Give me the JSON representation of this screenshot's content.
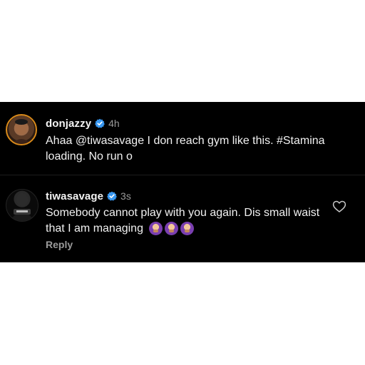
{
  "comments": [
    {
      "username": "donjazzy",
      "time": "4h",
      "text": "Ahaa @tiwasavage I don reach gym like this. #Stamina loading. No run o",
      "avatar_icon": "profile-photo-orange-ring-icon"
    },
    {
      "username": "tiwasavage",
      "time": "3s",
      "text": "Somebody cannot play with you again. Dis small waist that I am managing",
      "emojis": [
        "woman-shrugging-emoji",
        "woman-shrugging-emoji",
        "woman-shrugging-emoji"
      ],
      "reply_label": "Reply",
      "avatar_icon": "profile-photo-icon",
      "like_icon": "heart-outline-icon"
    }
  ],
  "colors": {
    "panel_bg": "#000000",
    "page_bg": "#ffffff",
    "verified_badge": "#3897f0",
    "muted_text": "#9a9a9a",
    "primary_text": "#f2f2f2",
    "story_ring": "#d98a1a"
  }
}
